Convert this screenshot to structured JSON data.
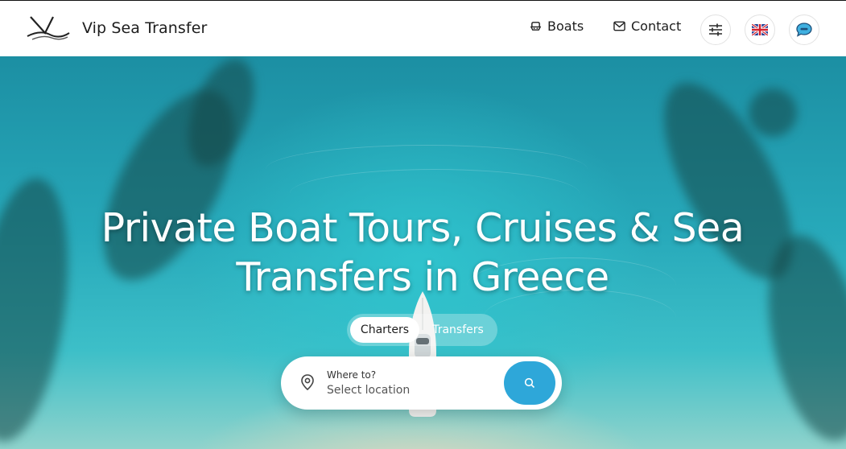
{
  "brand": {
    "name": "Vip Sea Transfer",
    "logo_icon": "wave-v-logo-icon"
  },
  "nav": {
    "boats_label": "Boats",
    "boats_icon": "boat-icon",
    "contact_label": "Contact",
    "contact_icon": "mail-icon",
    "filter_icon": "sliders-icon",
    "language_icon": "uk-flag-icon",
    "chat_icon": "chat-bubble-icon"
  },
  "hero": {
    "title": "Private Boat Tours, Cruises & Sea Transfers in Greece",
    "tabs": [
      {
        "label": "Charters",
        "active": true
      },
      {
        "label": "Transfers",
        "active": false
      }
    ],
    "search": {
      "label": "Where to?",
      "placeholder": "Select location",
      "button_icon": "search-icon"
    }
  },
  "colors": {
    "accent": "#2ea7d9",
    "navbar_bg": "#ffffff",
    "sea": "#27a9ba"
  }
}
